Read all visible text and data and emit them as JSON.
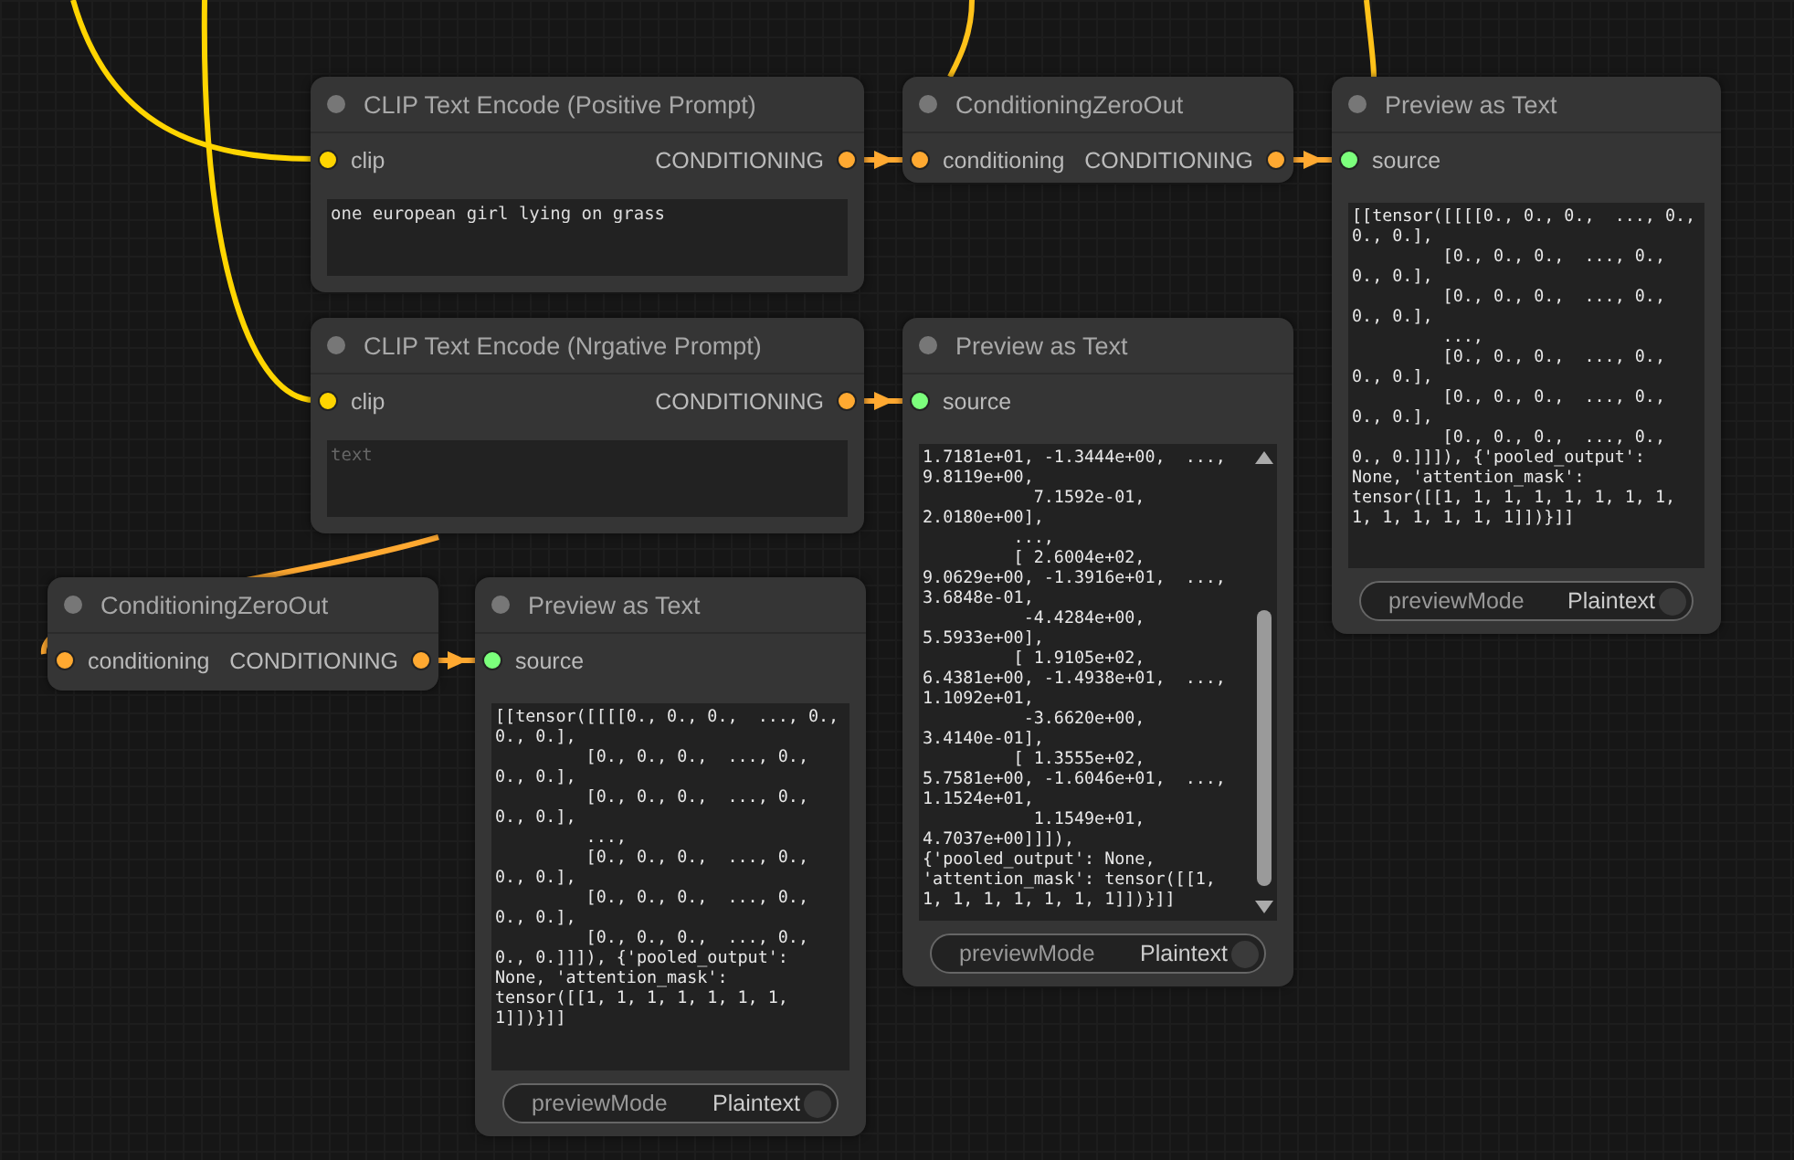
{
  "nodes": [
    {
      "kind": "encode",
      "title": "CLIP Text Encode (Positive Prompt)",
      "inputs": [
        {
          "label": "clip",
          "color": "#ffd500"
        }
      ],
      "outputs": [
        {
          "label": "CONDITIONING",
          "color": "#ffa931"
        }
      ],
      "text": {
        "value": "one european girl lying on grass"
      }
    },
    {
      "kind": "zero",
      "title": "ConditioningZeroOut",
      "inputs": [
        {
          "label": "conditioning",
          "color": "#ffa931"
        }
      ],
      "outputs": [
        {
          "label": "CONDITIONING",
          "color": "#ffa931"
        }
      ]
    },
    {
      "kind": "preview",
      "title": "Preview as Text",
      "inputs": [
        {
          "label": "source",
          "color": "#7cff7c"
        }
      ],
      "output_text": "[[tensor([[[[0., 0., 0.,  ..., 0.,\n0., 0.],\n         [0., 0., 0.,  ..., 0.,\n0., 0.],\n         [0., 0., 0.,  ..., 0.,\n0., 0.],\n         ...,\n         [0., 0., 0.,  ..., 0.,\n0., 0.],\n         [0., 0., 0.,  ..., 0.,\n0., 0.],\n         [0., 0., 0.,  ..., 0.,\n0., 0.]]]), {'pooled_output':\nNone, 'attention_mask':\ntensor([[1, 1, 1, 1, 1, 1, 1, 1,\n1, 1, 1, 1, 1, 1]])}]]",
      "scrollbar": false,
      "widget": {
        "label": "previewMode",
        "value": "Plaintext",
        "on": false
      }
    },
    {
      "kind": "encode",
      "title": "CLIP Text Encode (Nrgative Prompt)",
      "inputs": [
        {
          "label": "clip",
          "color": "#ffd500"
        }
      ],
      "outputs": [
        {
          "label": "CONDITIONING",
          "color": "#ffa931"
        }
      ],
      "text": {
        "placeholder": "text"
      }
    },
    {
      "kind": "preview",
      "title": "Preview as Text",
      "inputs": [
        {
          "label": "source",
          "color": "#7cff7c"
        }
      ],
      "output_text": "1.7181e+01, -1.3444e+00,  ...,\n9.8119e+00,\n           7.1592e-01,\n2.0180e+00],\n         ...,\n         [ 2.6004e+02,\n9.0629e+00, -1.3916e+01,  ...,\n3.6848e-01,\n          -4.4284e+00,\n5.5933e+00],\n         [ 1.9105e+02,\n6.4381e+00, -1.4938e+01,  ...,\n1.1092e+01,\n          -3.6620e+00,\n3.4140e-01],\n         [ 1.3555e+02,\n5.7581e+00, -1.6046e+01,  ...,\n1.1524e+01,\n           1.1549e+01,\n4.7037e+00]]]),\n{'pooled_output': None,\n'attention_mask': tensor([[1,\n1, 1, 1, 1, 1, 1, 1]])}]]",
      "scrollbar": true,
      "widget": {
        "label": "previewMode",
        "value": "Plaintext",
        "on": false
      }
    },
    {
      "kind": "zero",
      "title": "ConditioningZeroOut",
      "inputs": [
        {
          "label": "conditioning",
          "color": "#ffa931"
        }
      ],
      "outputs": [
        {
          "label": "CONDITIONING",
          "color": "#ffa931"
        }
      ]
    },
    {
      "kind": "preview",
      "title": "Preview as Text",
      "inputs": [
        {
          "label": "source",
          "color": "#7cff7c"
        }
      ],
      "output_text": "[[tensor([[[[0., 0., 0.,  ..., 0.,\n0., 0.],\n         [0., 0., 0.,  ..., 0.,\n0., 0.],\n         [0., 0., 0.,  ..., 0.,\n0., 0.],\n         ...,\n         [0., 0., 0.,  ..., 0.,\n0., 0.],\n         [0., 0., 0.,  ..., 0.,\n0., 0.],\n         [0., 0., 0.,  ..., 0.,\n0., 0.]]]), {'pooled_output':\nNone, 'attention_mask':\ntensor([[1, 1, 1, 1, 1, 1, 1,\n1]])}]]",
      "scrollbar": false,
      "widget": {
        "label": "previewMode",
        "value": "Plaintext",
        "on": false
      }
    }
  ]
}
